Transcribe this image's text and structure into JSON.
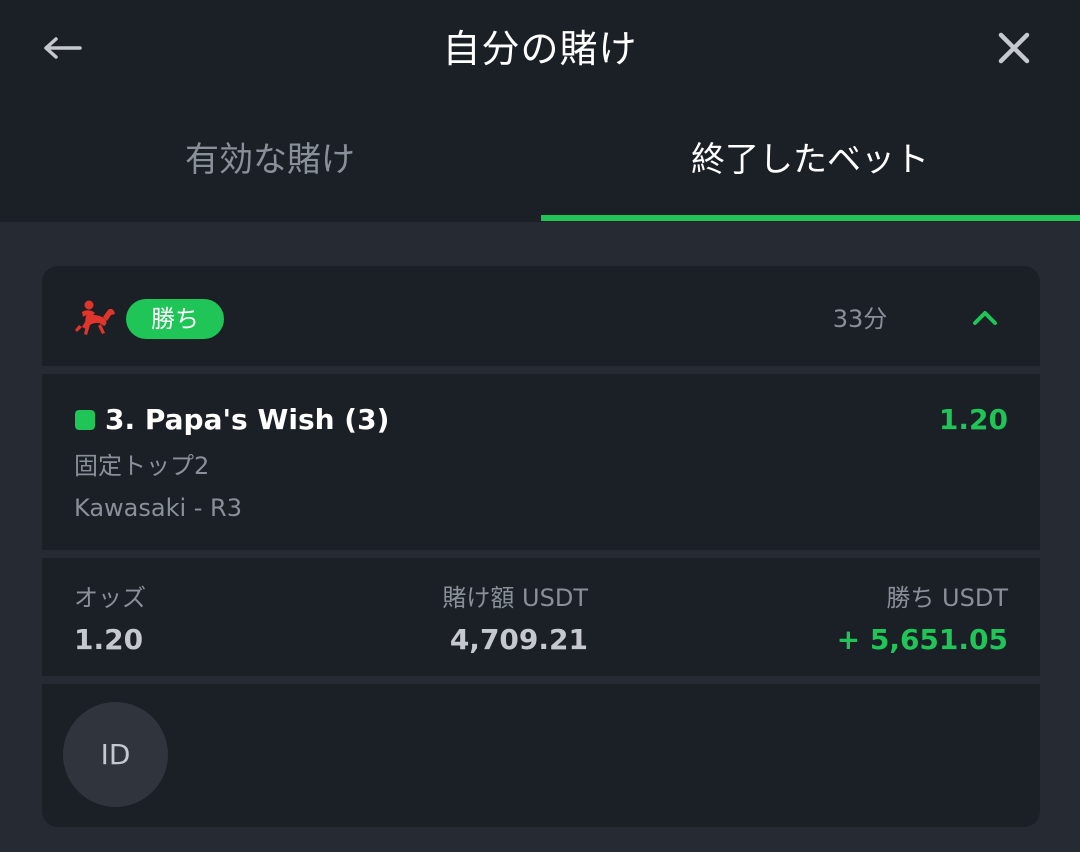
{
  "header": {
    "title": "自分の賭け",
    "back_icon": "arrow-left-icon",
    "close_icon": "close-icon"
  },
  "tabs": [
    {
      "label": "有効な賭け",
      "active": false
    },
    {
      "label": "終了したベット",
      "active": true
    }
  ],
  "bet": {
    "sport_icon": "horse-racing-icon",
    "status": "勝ち",
    "time_ago": "33分",
    "collapse_icon": "chevron-up-icon",
    "selection": {
      "name": "3. Papa's Wish (3)",
      "odds": "1.20",
      "market": "固定トップ2",
      "event": "Kawasaki - R3"
    },
    "amounts": {
      "odds_label": "オッズ",
      "odds_value": "1.20",
      "stake_label": "賭け額 USDT",
      "stake_value": "4,709.21",
      "win_label": "勝ち USDT",
      "win_value": "+ 5,651.05"
    },
    "id_label": "ID"
  },
  "colors": {
    "accent": "#1fc557",
    "header_bg": "#1b1f26",
    "page_bg": "#262b33",
    "card_bg": "#1b1f26",
    "muted_text": "#8a9099",
    "sport_icon": "#e0352b"
  }
}
